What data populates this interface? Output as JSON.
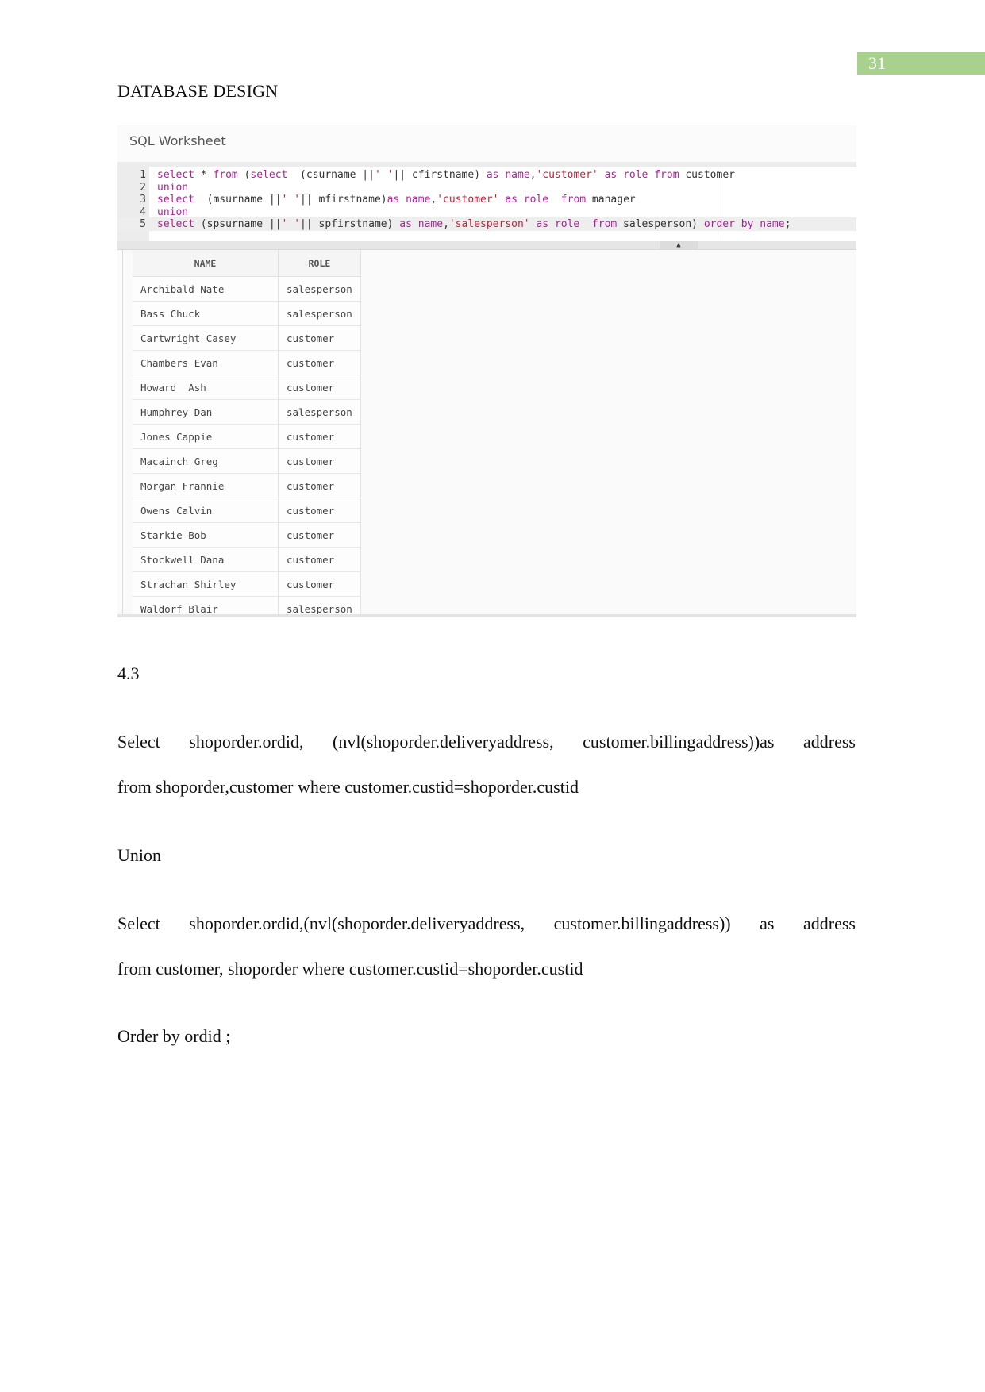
{
  "page": {
    "number": "31",
    "heading": "DATABASE DESIGN",
    "accent_color": "#a9d18e"
  },
  "worksheet": {
    "title": "SQL Worksheet",
    "code_lines": [
      {
        "num": "1",
        "tokens": [
          {
            "t": "kw",
            "v": "select"
          },
          {
            "t": "pl",
            "v": " * "
          },
          {
            "t": "kw",
            "v": "from"
          },
          {
            "t": "pl",
            "v": " ("
          },
          {
            "t": "kw",
            "v": "select"
          },
          {
            "t": "pl",
            "v": "  (csurname ||"
          },
          {
            "t": "str",
            "v": "' '"
          },
          {
            "t": "pl",
            "v": "|| cfirstname) "
          },
          {
            "t": "kw",
            "v": "as name"
          },
          {
            "t": "pl",
            "v": ","
          },
          {
            "t": "str",
            "v": "'customer'"
          },
          {
            "t": "pl",
            "v": " "
          },
          {
            "t": "kw",
            "v": "as role"
          },
          {
            "t": "pl",
            "v": " "
          },
          {
            "t": "kw",
            "v": "from"
          },
          {
            "t": "pl",
            "v": " customer"
          }
        ]
      },
      {
        "num": "2",
        "tokens": [
          {
            "t": "kw",
            "v": "union"
          }
        ]
      },
      {
        "num": "3",
        "tokens": [
          {
            "t": "kw",
            "v": "select"
          },
          {
            "t": "pl",
            "v": "  (msurname ||"
          },
          {
            "t": "str",
            "v": "' '"
          },
          {
            "t": "pl",
            "v": "|| mfirstname)"
          },
          {
            "t": "kw",
            "v": "as name"
          },
          {
            "t": "pl",
            "v": ","
          },
          {
            "t": "str",
            "v": "'customer'"
          },
          {
            "t": "pl",
            "v": " "
          },
          {
            "t": "kw",
            "v": "as role"
          },
          {
            "t": "pl",
            "v": "  "
          },
          {
            "t": "kw",
            "v": "from"
          },
          {
            "t": "pl",
            "v": " manager"
          }
        ]
      },
      {
        "num": "4",
        "tokens": [
          {
            "t": "kw",
            "v": "union"
          }
        ]
      },
      {
        "num": "5",
        "active": true,
        "tokens": [
          {
            "t": "kw",
            "v": "select"
          },
          {
            "t": "pl",
            "v": " (spsurname ||"
          },
          {
            "t": "str",
            "v": "' '"
          },
          {
            "t": "pl",
            "v": "|| spfirstname) "
          },
          {
            "t": "kw",
            "v": "as name"
          },
          {
            "t": "pl",
            "v": ","
          },
          {
            "t": "str",
            "v": "'salesperson'"
          },
          {
            "t": "pl",
            "v": " "
          },
          {
            "t": "kw",
            "v": "as role"
          },
          {
            "t": "pl",
            "v": "  "
          },
          {
            "t": "kw",
            "v": "from"
          },
          {
            "t": "pl",
            "v": " salesperson) "
          },
          {
            "t": "kw",
            "v": "order by name"
          },
          {
            "t": "pl",
            "v": ";"
          }
        ]
      }
    ],
    "splitter_icon": "triangle-up-icon",
    "results": {
      "columns": [
        "NAME",
        "ROLE"
      ],
      "rows": [
        [
          "Archibald Nate",
          "salesperson"
        ],
        [
          "Bass Chuck",
          "salesperson"
        ],
        [
          "Cartwright Casey",
          "customer"
        ],
        [
          "Chambers Evan",
          "customer"
        ],
        [
          "Howard  Ash",
          "customer"
        ],
        [
          "Humphrey Dan",
          "salesperson"
        ],
        [
          "Jones Cappie",
          "customer"
        ],
        [
          "Macainch Greg",
          "customer"
        ],
        [
          "Morgan Frannie",
          "customer"
        ],
        [
          "Owens Calvin",
          "customer"
        ],
        [
          "Starkie Bob",
          "customer"
        ],
        [
          "Stockwell Dana",
          "customer"
        ],
        [
          "Strachan Shirley",
          "customer"
        ],
        [
          "Waldorf Blair",
          "salesperson"
        ]
      ]
    }
  },
  "section": {
    "number": "4.3",
    "query1_line1": "Select shoporder.ordid, (nvl(shoporder.deliveryaddress, customer.billingaddress))as address",
    "query1_line2": "from shoporder,customer where customer.custid=shoporder.custid",
    "union": "Union",
    "query2_line1": "Select shoporder.ordid,(nvl(shoporder.deliveryaddress, customer.billingaddress)) as address",
    "query2_line2": "from customer, shoporder where customer.custid=shoporder.custid",
    "order_by": "Order by ordid ;"
  }
}
